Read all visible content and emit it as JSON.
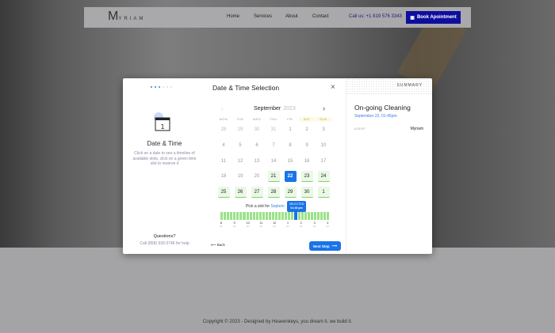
{
  "nav": {
    "logo": "M",
    "logo_rest": "YRIAM",
    "items": [
      "Home",
      "Services",
      "About",
      "Contact"
    ],
    "call": "Call us: +1 819 576 3343",
    "book": "Book Apointment"
  },
  "modal": {
    "title": "Date & Time Selection",
    "close": "×",
    "left": {
      "icon_number": "1",
      "heading": "Date & Time",
      "description": "Click on a date to see a timeline of available slots, click on a green time slot to reserve it",
      "questions": "Questions?",
      "call": "Call (858) 939-3746 for help"
    },
    "calendar": {
      "month": "September",
      "year": "2023",
      "weekdays": [
        "MON",
        "TUE",
        "WED",
        "THU",
        "FRI",
        "SAT",
        "SUN"
      ],
      "days": [
        [
          {
            "d": "28",
            "s": "mute"
          },
          {
            "d": "29",
            "s": "mute"
          },
          {
            "d": "30",
            "s": "mute"
          },
          {
            "d": "31",
            "s": "mute"
          },
          {
            "d": "1",
            "s": ""
          },
          {
            "d": "2",
            "s": ""
          },
          {
            "d": "3",
            "s": ""
          }
        ],
        [
          {
            "d": "4",
            "s": ""
          },
          {
            "d": "5",
            "s": ""
          },
          {
            "d": "6",
            "s": ""
          },
          {
            "d": "7",
            "s": ""
          },
          {
            "d": "8",
            "s": ""
          },
          {
            "d": "9",
            "s": ""
          },
          {
            "d": "10",
            "s": ""
          }
        ],
        [
          {
            "d": "11",
            "s": ""
          },
          {
            "d": "12",
            "s": ""
          },
          {
            "d": "13",
            "s": ""
          },
          {
            "d": "14",
            "s": ""
          },
          {
            "d": "15",
            "s": ""
          },
          {
            "d": "16",
            "s": ""
          },
          {
            "d": "17",
            "s": ""
          }
        ],
        [
          {
            "d": "18",
            "s": ""
          },
          {
            "d": "19",
            "s": ""
          },
          {
            "d": "20",
            "s": ""
          },
          {
            "d": "21",
            "s": "av"
          },
          {
            "d": "22",
            "s": "sel"
          },
          {
            "d": "23",
            "s": "av"
          },
          {
            "d": "24",
            "s": "av"
          }
        ],
        [
          {
            "d": "25",
            "s": "av"
          },
          {
            "d": "26",
            "s": "av"
          },
          {
            "d": "27",
            "s": "av"
          },
          {
            "d": "28",
            "s": "av"
          },
          {
            "d": "29",
            "s": "av"
          },
          {
            "d": "30",
            "s": "av"
          },
          {
            "d": "1",
            "s": "av"
          }
        ]
      ],
      "pick_label": "Pick a slot for",
      "pick_date": "Septem",
      "tooltip_label": "SELECTED",
      "tooltip_time": "01:45 pm",
      "slot_count": 34,
      "selected_slot": 23,
      "ticks": [
        {
          "h": "8",
          "p": "am"
        },
        {
          "h": "9",
          "p": "am"
        },
        {
          "h": "10",
          "p": "am"
        },
        {
          "h": "11",
          "p": "am"
        },
        {
          "h": "12",
          "p": "pm"
        },
        {
          "h": "1",
          "p": "pm"
        },
        {
          "h": "2",
          "p": "pm"
        },
        {
          "h": "3",
          "p": "pm"
        },
        {
          "h": "4",
          "p": "pm"
        }
      ]
    },
    "back": "Back",
    "next": "Next Step",
    "summary": {
      "header": "SUMMARY",
      "service": "On-going Cleaning",
      "datetime": "September 22, 01:45pm",
      "agent_label": "AGENT",
      "agent": "Myriam"
    }
  },
  "footer": "Copyright © 2023 - Designed by Heavenkeys, you dream it, we build it.",
  "colors": {
    "accent": "#1a73e8",
    "available": "#9be28a",
    "brand": "#0e0e9e"
  }
}
